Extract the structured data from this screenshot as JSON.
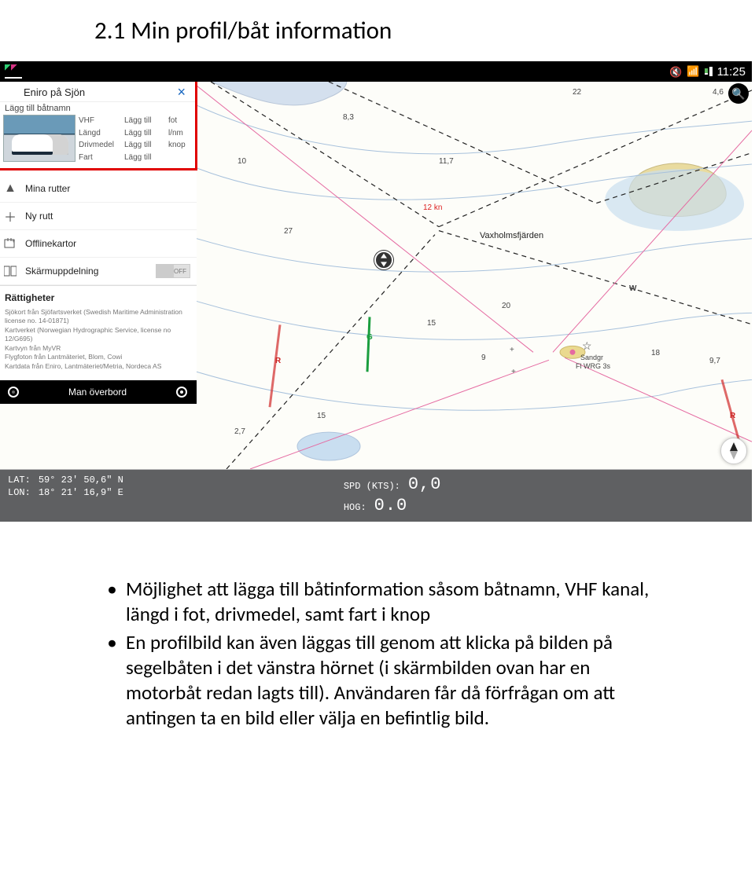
{
  "heading": "2.1 Min profil/båt information",
  "statusbar": {
    "time": "11:25"
  },
  "sidebar": {
    "appTitle": "Eniro på Sjön",
    "addBoatName": "Lägg till båtnamn",
    "specs": {
      "col1": [
        "VHF",
        "Längd",
        "Drivmedel",
        "Fart"
      ],
      "col2": [
        "Lägg till",
        "Lägg till",
        "Lägg till",
        "Lägg till"
      ],
      "col3": [
        "",
        "fot",
        "l/nm",
        "knop"
      ]
    },
    "rows": {
      "routes": "Mina rutter",
      "newRoute": "Ny rutt",
      "offline": "Offlinekartor",
      "split": "Skärmuppdelning",
      "splitToggle": "OFF"
    },
    "rights": {
      "title": "Rättigheter",
      "lines": [
        "Sjökort från Sjöfartsverket (Swedish Maritime Administration license no. 14-01871)",
        "Kartverket (Norwegian Hydrographic Service, license no 12/G695)",
        "Kartvyn från MyVR",
        "Flygfoton från Lantmäteriet, Blom, Cowi",
        "Kartdata från Eniro, Lantmäteriet/Metria, Nordeca AS"
      ]
    },
    "mob": "Man överbord"
  },
  "databar": {
    "latLabel": "LAT:",
    "latValue": "59° 23' 50,6\" N",
    "lonLabel": "LON:",
    "lonValue": "18° 21' 16,9\" E",
    "spdLabel": "SPD (KTS):",
    "spdValue": "0,0",
    "hogLabel": "HOG:",
    "hogValue": "0.0"
  },
  "map": {
    "soundings": {
      "s83": "8,3",
      "s117": "11,7",
      "s27": "27",
      "s10": "10",
      "s15a": "15",
      "s15b": "15",
      "s20": "20",
      "s9": "9",
      "s18": "18",
      "s97": "9,7",
      "s27b": "2,7",
      "s46": "4,6",
      "s22": "22"
    },
    "kn": "12 kn",
    "vax": "Vaxholmsfjärden",
    "letters": {
      "G": "G",
      "R1": "R",
      "R2": "R",
      "W": "W"
    },
    "sandgr1": "Sandgr",
    "sandgr2": "Fl WRG 3s",
    "star": "☆"
  },
  "bullets": [
    "Möjlighet att lägga till båtinformation såsom båtnamn, VHF kanal, längd i fot, drivmedel, samt fart i knop",
    "En profilbild kan även läggas till genom att klicka på bilden på segelbåten i det vänstra hörnet (i skärmbilden ovan har en motorbåt redan lagts till). Användaren får då förfrågan om att antingen ta en bild eller välja en befintlig bild."
  ]
}
